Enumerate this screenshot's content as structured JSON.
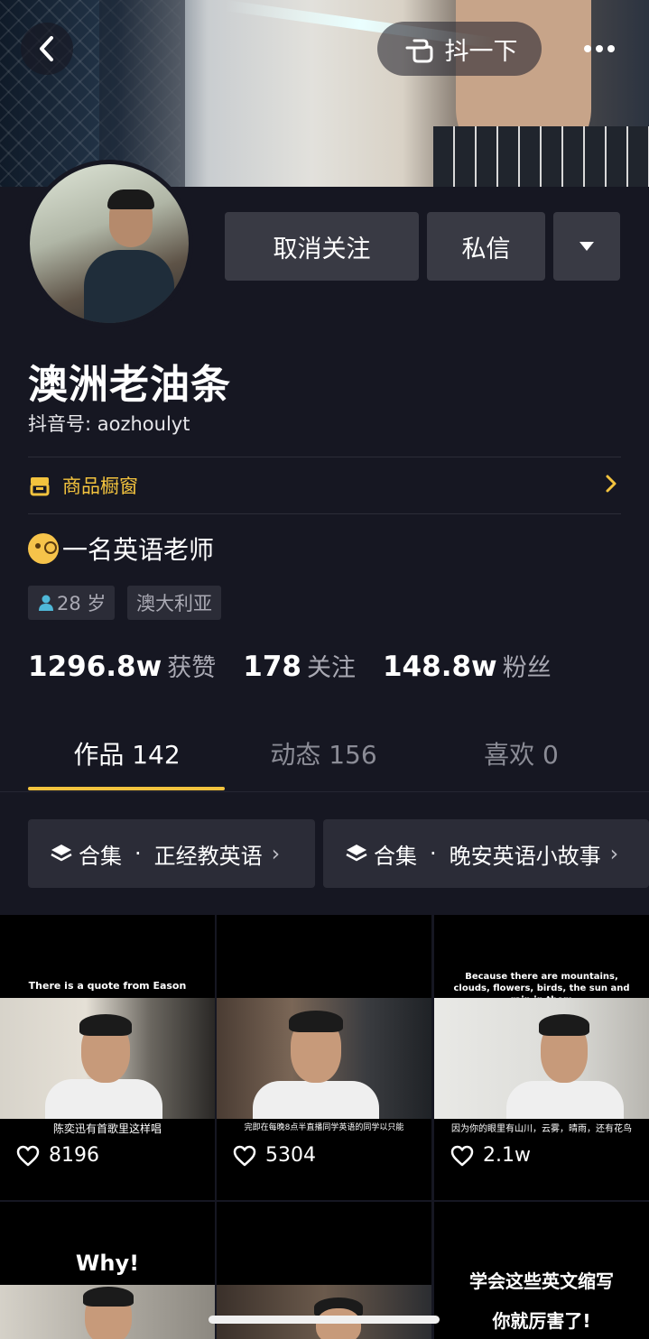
{
  "header": {
    "shake_label": "抖一下"
  },
  "profile": {
    "unfollow_label": "取消关注",
    "message_label": "私信",
    "name": "澳洲老油条",
    "douyin_id": "抖音号: aozhoulyt",
    "shop_label": "商品橱窗",
    "bio": "一名英语老师",
    "tags": [
      "28 岁",
      "澳大利亚"
    ]
  },
  "stats": [
    {
      "num": "1296.8w",
      "label": "获赞"
    },
    {
      "num": "178",
      "label": "关注"
    },
    {
      "num": "148.8w",
      "label": "粉丝"
    }
  ],
  "tabs": [
    {
      "label": "作品 142"
    },
    {
      "label": "动态 156"
    },
    {
      "label": "喜欢 0"
    }
  ],
  "collections": [
    {
      "prefix": "合集",
      "dot": "·",
      "title": "正经教英语"
    },
    {
      "prefix": "合集",
      "dot": "·",
      "title": "晚安英语小故事"
    }
  ],
  "videos": [
    {
      "caption_top": "There is a quote from Eason",
      "caption_bottom": "陈奕迅有首歌里这样唱",
      "likes": "8196"
    },
    {
      "caption_top": "",
      "caption_bottom": "完即在每晚8点半直播同学英语的同学以只能",
      "likes": "5304"
    },
    {
      "caption_top": "Because there are mountains, clouds, flowers, birds, the sun and rain in them",
      "caption_bottom": "因为你的眼里有山川，云雾，晴雨，还有花鸟",
      "likes": "2.1w"
    },
    {
      "caption_top": "Why!",
      "caption_bottom": "",
      "likes": ""
    },
    {
      "caption_top": "",
      "caption_bottom": "",
      "likes": ""
    },
    {
      "caption_top": "学会这些英文缩写",
      "caption_bottom": "你就厉害了!",
      "likes": ""
    }
  ],
  "colors": {
    "background": "#161722",
    "accent": "#f3c33e",
    "button": "#393a44"
  }
}
